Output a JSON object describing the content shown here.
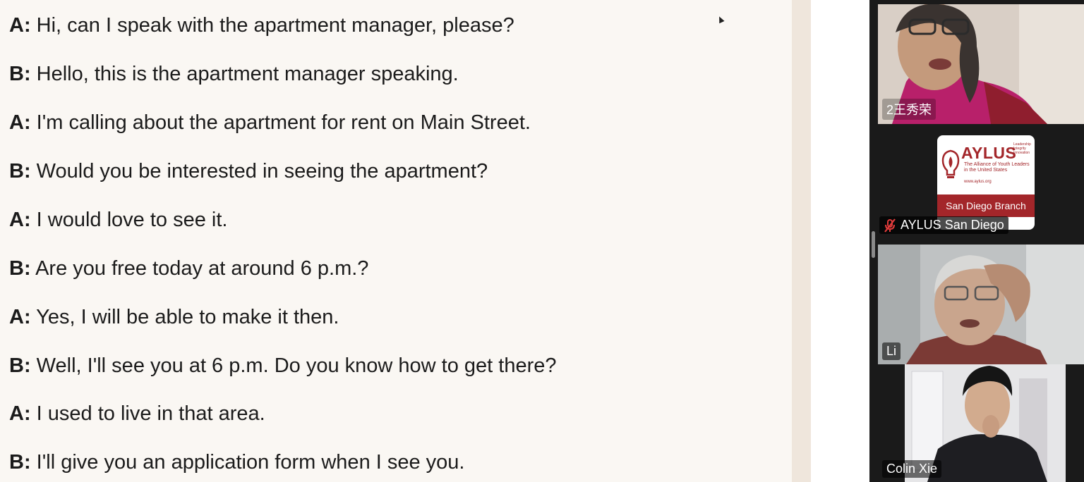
{
  "dialogue": [
    {
      "speaker": "A:",
      "text": "Hi, can I speak with the apartment manager, please?"
    },
    {
      "speaker": "B:",
      "text": "Hello, this is the apartment manager speaking."
    },
    {
      "speaker": "A:",
      "text": "I'm calling about the apartment for rent on Main Street."
    },
    {
      "speaker": "B:",
      "text": "Would you be interested in seeing the apartment?"
    },
    {
      "speaker": "A:",
      "text": "I would love to see it."
    },
    {
      "speaker": "B:",
      "text": "Are you free today at around 6 p.m.?"
    },
    {
      "speaker": "A:",
      "text": "Yes, I will be able to make it then."
    },
    {
      "speaker": "B:",
      "text": "Well, I'll see you at 6 p.m. Do you know how to get there?"
    },
    {
      "speaker": "A:",
      "text": "I used to live in that area."
    },
    {
      "speaker": "B:",
      "text": "I'll give you an application form when I see you."
    }
  ],
  "participants": [
    {
      "name": "2王秀荣",
      "speaking": true,
      "muted": false
    },
    {
      "name": "AYLUS San Diego",
      "speaking": false,
      "muted": true
    },
    {
      "name": "Li",
      "speaking": false,
      "muted": false
    },
    {
      "name": "Colin Xie",
      "speaking": false,
      "muted": false
    }
  ],
  "logo": {
    "brand": "AYLUS",
    "side_text": "Leadership Integrity Innovation",
    "tagline": "The Alliance of Youth Leaders in the United States",
    "url": "www.aylus.org",
    "branch": "San Diego Branch"
  },
  "colors": {
    "accent": "#a3262a",
    "active_border": "#5cd65c",
    "panel_bg": "#1a1a1a",
    "doc_bg": "#faf7f3"
  },
  "icons": {
    "muted": "mic-off-icon",
    "cursor": "mouse-pointer-icon"
  }
}
